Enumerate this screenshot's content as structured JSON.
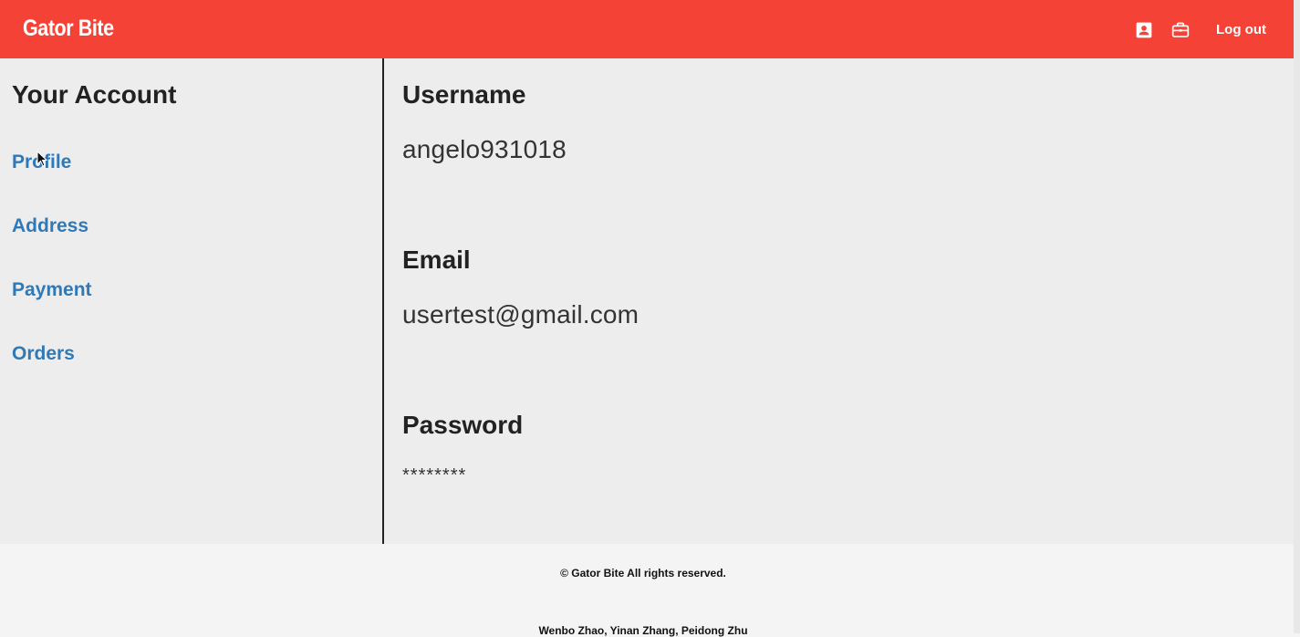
{
  "header": {
    "brand": "Gator Bite",
    "icons": [
      "account-box-icon",
      "briefcase-icon"
    ],
    "logout_label": "Log out",
    "bg_color": "#f44336"
  },
  "sidebar": {
    "title": "Your Account",
    "items": [
      {
        "label": "Profile"
      },
      {
        "label": "Address"
      },
      {
        "label": "Payment"
      },
      {
        "label": "Orders"
      }
    ],
    "link_color": "#3079b8"
  },
  "main": {
    "username": {
      "label": "Username",
      "value": "angelo931018"
    },
    "email": {
      "label": "Email",
      "value": "usertest@gmail.com"
    },
    "password": {
      "label": "Password",
      "value": "********"
    }
  },
  "footer": {
    "copyright": "© Gator Bite All rights reserved.",
    "authors": "Wenbo Zhao, Yinan Zhang, Peidong Zhu"
  }
}
